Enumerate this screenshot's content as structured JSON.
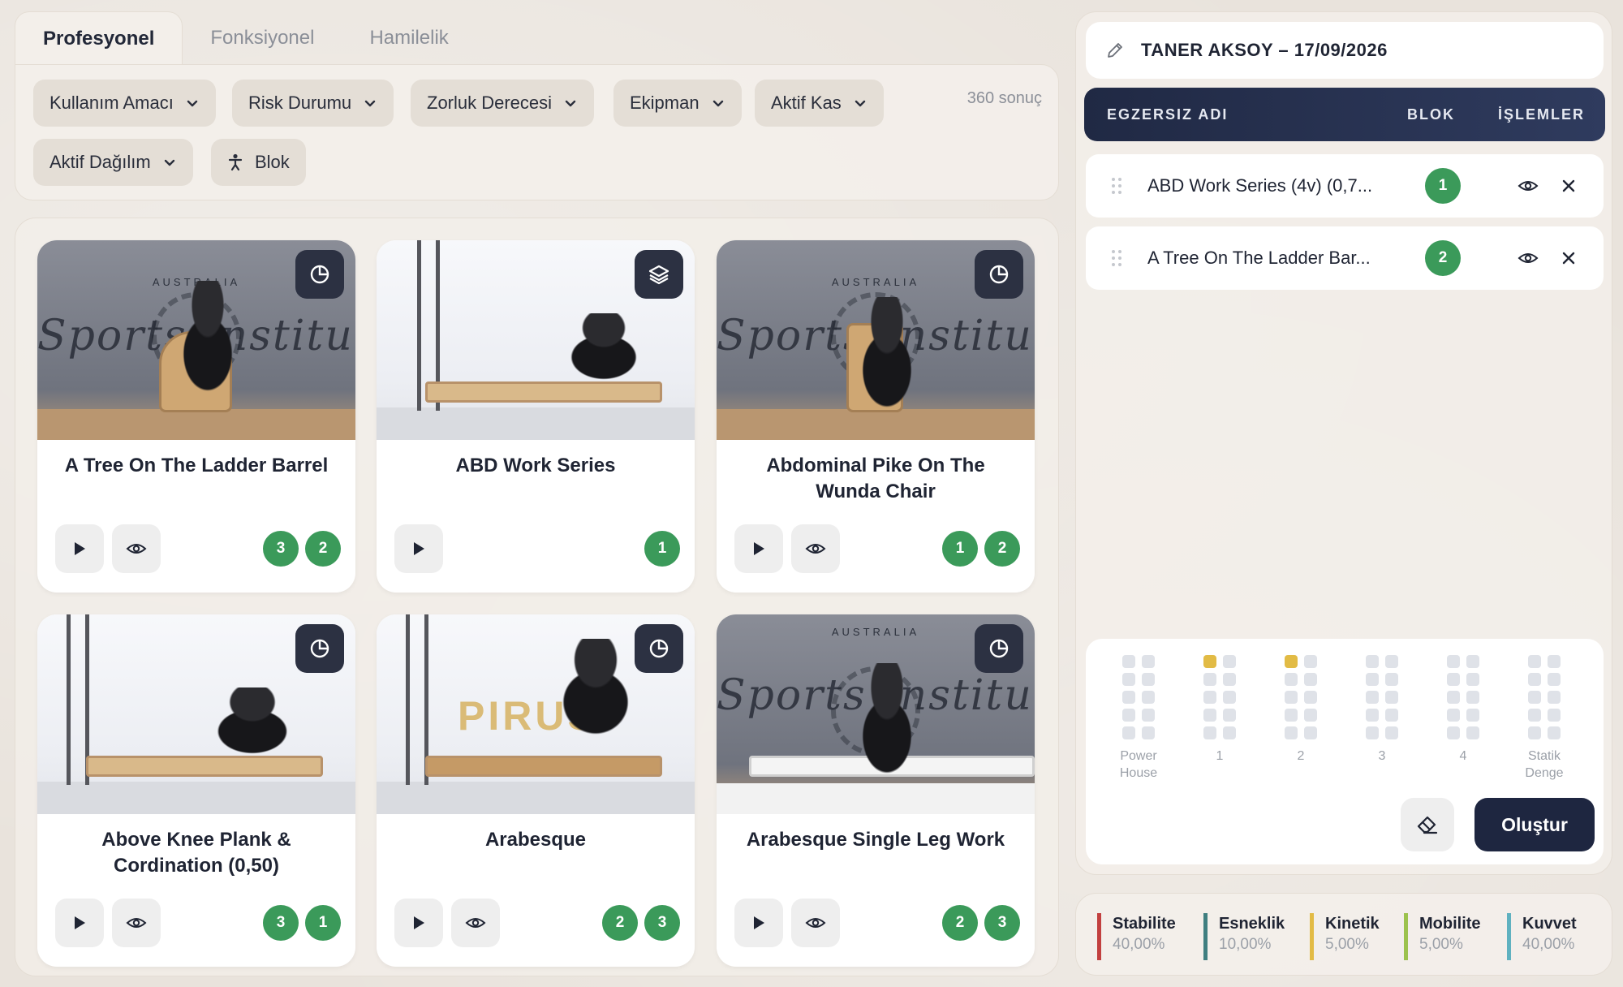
{
  "tabs": [
    {
      "label": "Profesyonel",
      "active": true
    },
    {
      "label": "Fonksiyonel",
      "active": false
    },
    {
      "label": "Hamilelik",
      "active": false
    }
  ],
  "filters": {
    "items": [
      {
        "label": "Kullanım Amacı",
        "icon": "chevron-down-icon"
      },
      {
        "label": "Risk Durumu",
        "icon": "chevron-down-icon"
      },
      {
        "label": "Zorluk Derecesi",
        "icon": "chevron-down-icon"
      },
      {
        "label": "Ekipman",
        "icon": "chevron-down-icon"
      },
      {
        "label": "Aktif Kas",
        "icon": "chevron-down-icon"
      },
      {
        "label": "Aktif Dağılım",
        "icon": "chevron-down-icon"
      },
      {
        "label": "Blok",
        "icon": "person-icon"
      }
    ],
    "result_count": "360 sonuç"
  },
  "cards": [
    {
      "title": "A Tree On The Ladder Barrel",
      "badge_icon": "pie-chart-icon",
      "brand": "Sports Institute",
      "brand_top": "AUSTRALIA",
      "has_eye": true,
      "nums": [
        "3",
        "2"
      ]
    },
    {
      "title": "ABD Work Series",
      "badge_icon": "layers-icon",
      "brand": "",
      "brand_top": "",
      "has_eye": false,
      "nums": [
        "1"
      ]
    },
    {
      "title": "Abdominal Pike On The Wunda Chair",
      "badge_icon": "pie-chart-icon",
      "brand": "Sports Institute",
      "brand_top": "AUSTRALIA",
      "has_eye": true,
      "nums": [
        "1",
        "2"
      ]
    },
    {
      "title": "Above Knee Plank & Cordination (0,50)",
      "badge_icon": "pie-chart-icon",
      "brand": "",
      "brand_top": "",
      "has_eye": true,
      "nums": [
        "3",
        "1"
      ]
    },
    {
      "title": "Arabesque",
      "badge_icon": "pie-chart-icon",
      "brand": "PIRUS",
      "brand_top": "",
      "has_eye": true,
      "nums": [
        "2",
        "3"
      ]
    },
    {
      "title": "Arabesque Single Leg Work",
      "badge_icon": "pie-chart-icon",
      "brand": "Sports Institut",
      "brand_top": "AUSTRALIA",
      "has_eye": true,
      "nums": [
        "2",
        "3"
      ]
    }
  ],
  "program": {
    "name": "TANER AKSOY – 17/09/2026",
    "headers": {
      "name": "EGZERSIZ ADI",
      "block": "BLOK",
      "actions": "İŞLEMLER"
    },
    "rows": [
      {
        "name": "ABD Work Series (4v) (0,7...",
        "block": "1"
      },
      {
        "name": "A Tree On The Ladder Bar...",
        "block": "2"
      }
    ]
  },
  "blocks": [
    {
      "label": "Power House",
      "filled": 0
    },
    {
      "label": "1",
      "filled": 1
    },
    {
      "label": "2",
      "filled": 1
    },
    {
      "label": "3",
      "filled": 0
    },
    {
      "label": "4",
      "filled": 0
    },
    {
      "label": "Statik Denge",
      "filled": 0
    }
  ],
  "actions": {
    "create_label": "Oluştur"
  },
  "stats": [
    {
      "label": "Stabilite",
      "value": "40,00%",
      "color": "#c2403f"
    },
    {
      "label": "Esneklik",
      "value": "10,00%",
      "color": "#3f7f80"
    },
    {
      "label": "Kinetik",
      "value": "5,00%",
      "color": "#e2bb45"
    },
    {
      "label": "Mobilite",
      "value": "5,00%",
      "color": "#9cc24d"
    },
    {
      "label": "Kuvvet",
      "value": "40,00%",
      "color": "#5fb1c0"
    }
  ],
  "colors": {
    "accent_dark": "#1e2640",
    "badge_green": "#3b9a5a",
    "block_on": "#e2bb45"
  }
}
